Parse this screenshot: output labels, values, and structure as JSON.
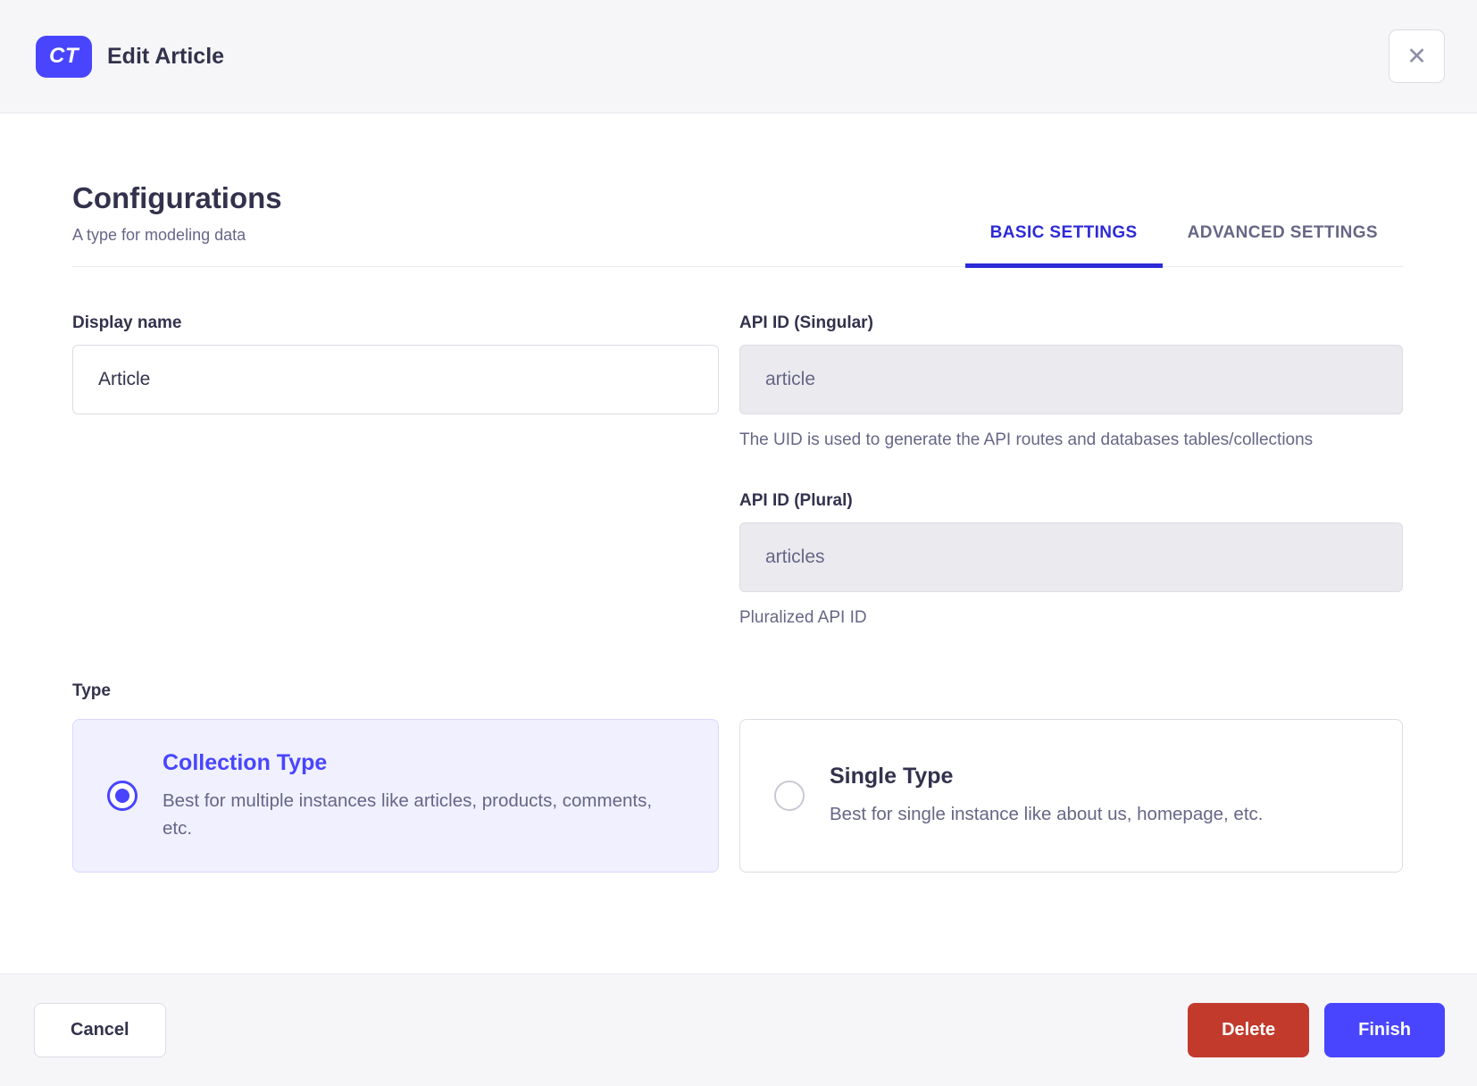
{
  "header": {
    "badge": "CT",
    "title": "Edit Article",
    "close_icon": "✕"
  },
  "section": {
    "title": "Configurations",
    "subtitle": "A type for modeling data",
    "tabs": [
      {
        "label": "BASIC SETTINGS",
        "active": true
      },
      {
        "label": "ADVANCED SETTINGS",
        "active": false
      }
    ]
  },
  "form": {
    "display_name": {
      "label": "Display name",
      "value": "Article"
    },
    "api_id_singular": {
      "label": "API ID (Singular)",
      "value": "article",
      "help": "The UID is used to generate the API routes and databases tables/collections"
    },
    "api_id_plural": {
      "label": "API ID (Plural)",
      "value": "articles",
      "help": "Pluralized API ID"
    },
    "type": {
      "label": "Type",
      "options": [
        {
          "title": "Collection Type",
          "description": "Best for multiple instances like articles, products, comments, etc.",
          "selected": true
        },
        {
          "title": "Single Type",
          "description": "Best for single instance like about us, homepage, etc.",
          "selected": false
        }
      ]
    }
  },
  "footer": {
    "cancel": "Cancel",
    "delete": "Delete",
    "finish": "Finish"
  },
  "colors": {
    "accent": "#4945ff",
    "tab_active": "#2d2ad8",
    "danger": "#c23a2c",
    "text_dark": "#32324d",
    "text_gray": "#666687",
    "surface_gray": "#f6f6f9",
    "border": "#dcdce4",
    "divider": "#eaeaef",
    "disabled_input_bg": "#eaeaef",
    "selected_card_bg": "#f0f0ff",
    "selected_card_border": "#d9d8ff"
  }
}
